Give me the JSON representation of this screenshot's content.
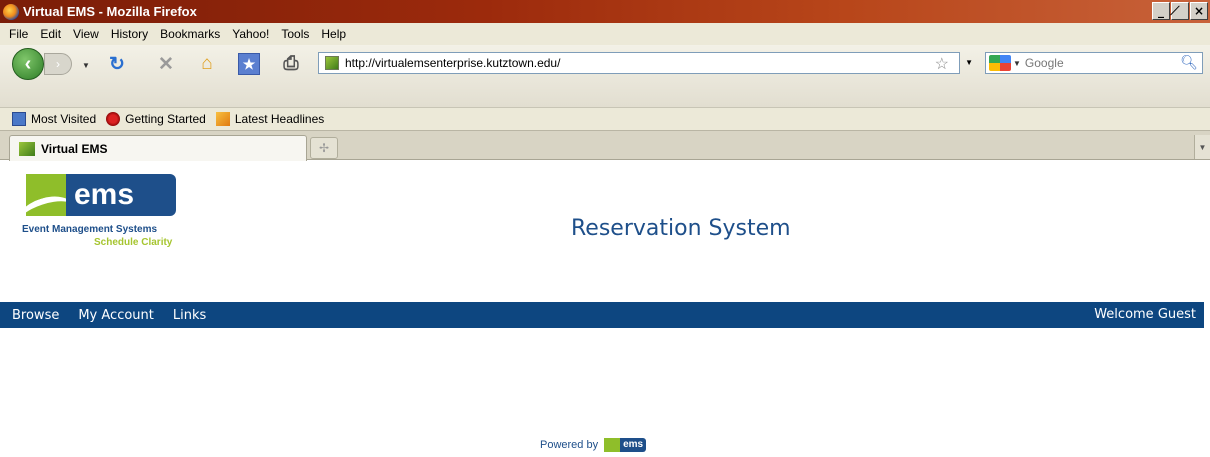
{
  "window": {
    "title": "Virtual EMS - Mozilla Firefox",
    "controls": [
      "_",
      "̸",
      "×"
    ]
  },
  "menu": {
    "items": [
      "File",
      "Edit",
      "View",
      "History",
      "Bookmarks",
      "Yahoo!",
      "Tools",
      "Help"
    ]
  },
  "toolbar": {
    "url": "http://virtualemsenterprise.kutztown.edu/",
    "search_placeholder": "Google"
  },
  "bookmarks": {
    "items": [
      "Most Visited",
      "Getting Started",
      "Latest Headlines"
    ]
  },
  "tabs": {
    "active_label": "Virtual EMS"
  },
  "page": {
    "logo_text": "ems",
    "logo_subtitle": "Event Management Systems",
    "logo_tagline": "Schedule Clarity",
    "title": "Reservation System",
    "nav": {
      "links": [
        "Browse",
        "My Account",
        "Links"
      ],
      "welcome": "Welcome Guest"
    },
    "footer": {
      "powered_by": "Powered by",
      "logo_text": "ems"
    }
  },
  "colors": {
    "accent": "#0d4680",
    "brand_green": "#8fbe2a",
    "brand_blue": "#1e4f8a"
  }
}
